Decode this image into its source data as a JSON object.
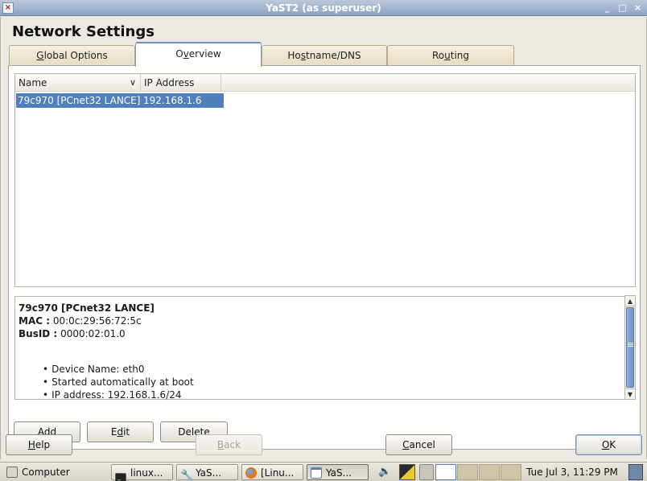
{
  "window": {
    "title": "YaST2 (as superuser)",
    "close_glyph": "×",
    "controls": [
      "_",
      "□",
      "×"
    ]
  },
  "page_title": "Network Settings",
  "tabs": [
    {
      "label": "Global Options",
      "mnemonic": "G",
      "rest": "lobal Options",
      "active": false
    },
    {
      "label": "Overview",
      "mnemonic": "v",
      "pre": "O",
      "rest": "erview",
      "active": true
    },
    {
      "label": "Hostname/DNS",
      "mnemonic": "s",
      "pre": "Ho",
      "rest": "tname/DNS",
      "active": false
    },
    {
      "label": "Routing",
      "mnemonic": "u",
      "pre": "Ro",
      "rest": "ting",
      "active": false
    }
  ],
  "table": {
    "columns": [
      "Name",
      "IP Address"
    ],
    "sort_glyph": "∨",
    "rows": [
      {
        "name": "79c970 [PCnet32 LANCE]",
        "ip": "192.168.1.6",
        "selected": true
      }
    ]
  },
  "details": {
    "heading": "79c970 [PCnet32 LANCE]",
    "mac_label": "MAC :",
    "mac_value": "00:0c:29:56:72:5c",
    "busid_label": "BusID :",
    "busid_value": "0000:02:01.0",
    "bullets": [
      "Device Name: eth0",
      "Started automatically at boot",
      "IP address: 192.168.1.6/24"
    ]
  },
  "list_buttons": {
    "add": {
      "pre": "",
      "mn": "A",
      "rest": "dd"
    },
    "edit": {
      "pre": "E",
      "mn": "d",
      "rest": "it"
    },
    "delete": {
      "pre": "Delet",
      "mn": "e",
      "rest": ""
    }
  },
  "dialog_buttons": {
    "help": {
      "pre": "",
      "mn": "H",
      "rest": "elp"
    },
    "back": {
      "pre": "",
      "mn": "B",
      "rest": "ack",
      "disabled": true
    },
    "cancel": {
      "pre": "",
      "mn": "C",
      "rest": "ancel"
    },
    "ok": {
      "pre": "",
      "mn": "O",
      "rest": "K"
    }
  },
  "taskbar": {
    "computer": "Computer",
    "tasks": [
      {
        "label": "linux...",
        "icon": "terminal-icon"
      },
      {
        "label": "YaS...",
        "icon": "wrench-icon"
      },
      {
        "label": "[Linu...",
        "icon": "firefox-icon"
      },
      {
        "label": "YaS...",
        "icon": "window-icon",
        "active": true
      }
    ],
    "clock": "Tue Jul  3, 11:29 PM"
  },
  "colors": {
    "selection": "#4f7fbd",
    "accent": "#6b92c6"
  }
}
